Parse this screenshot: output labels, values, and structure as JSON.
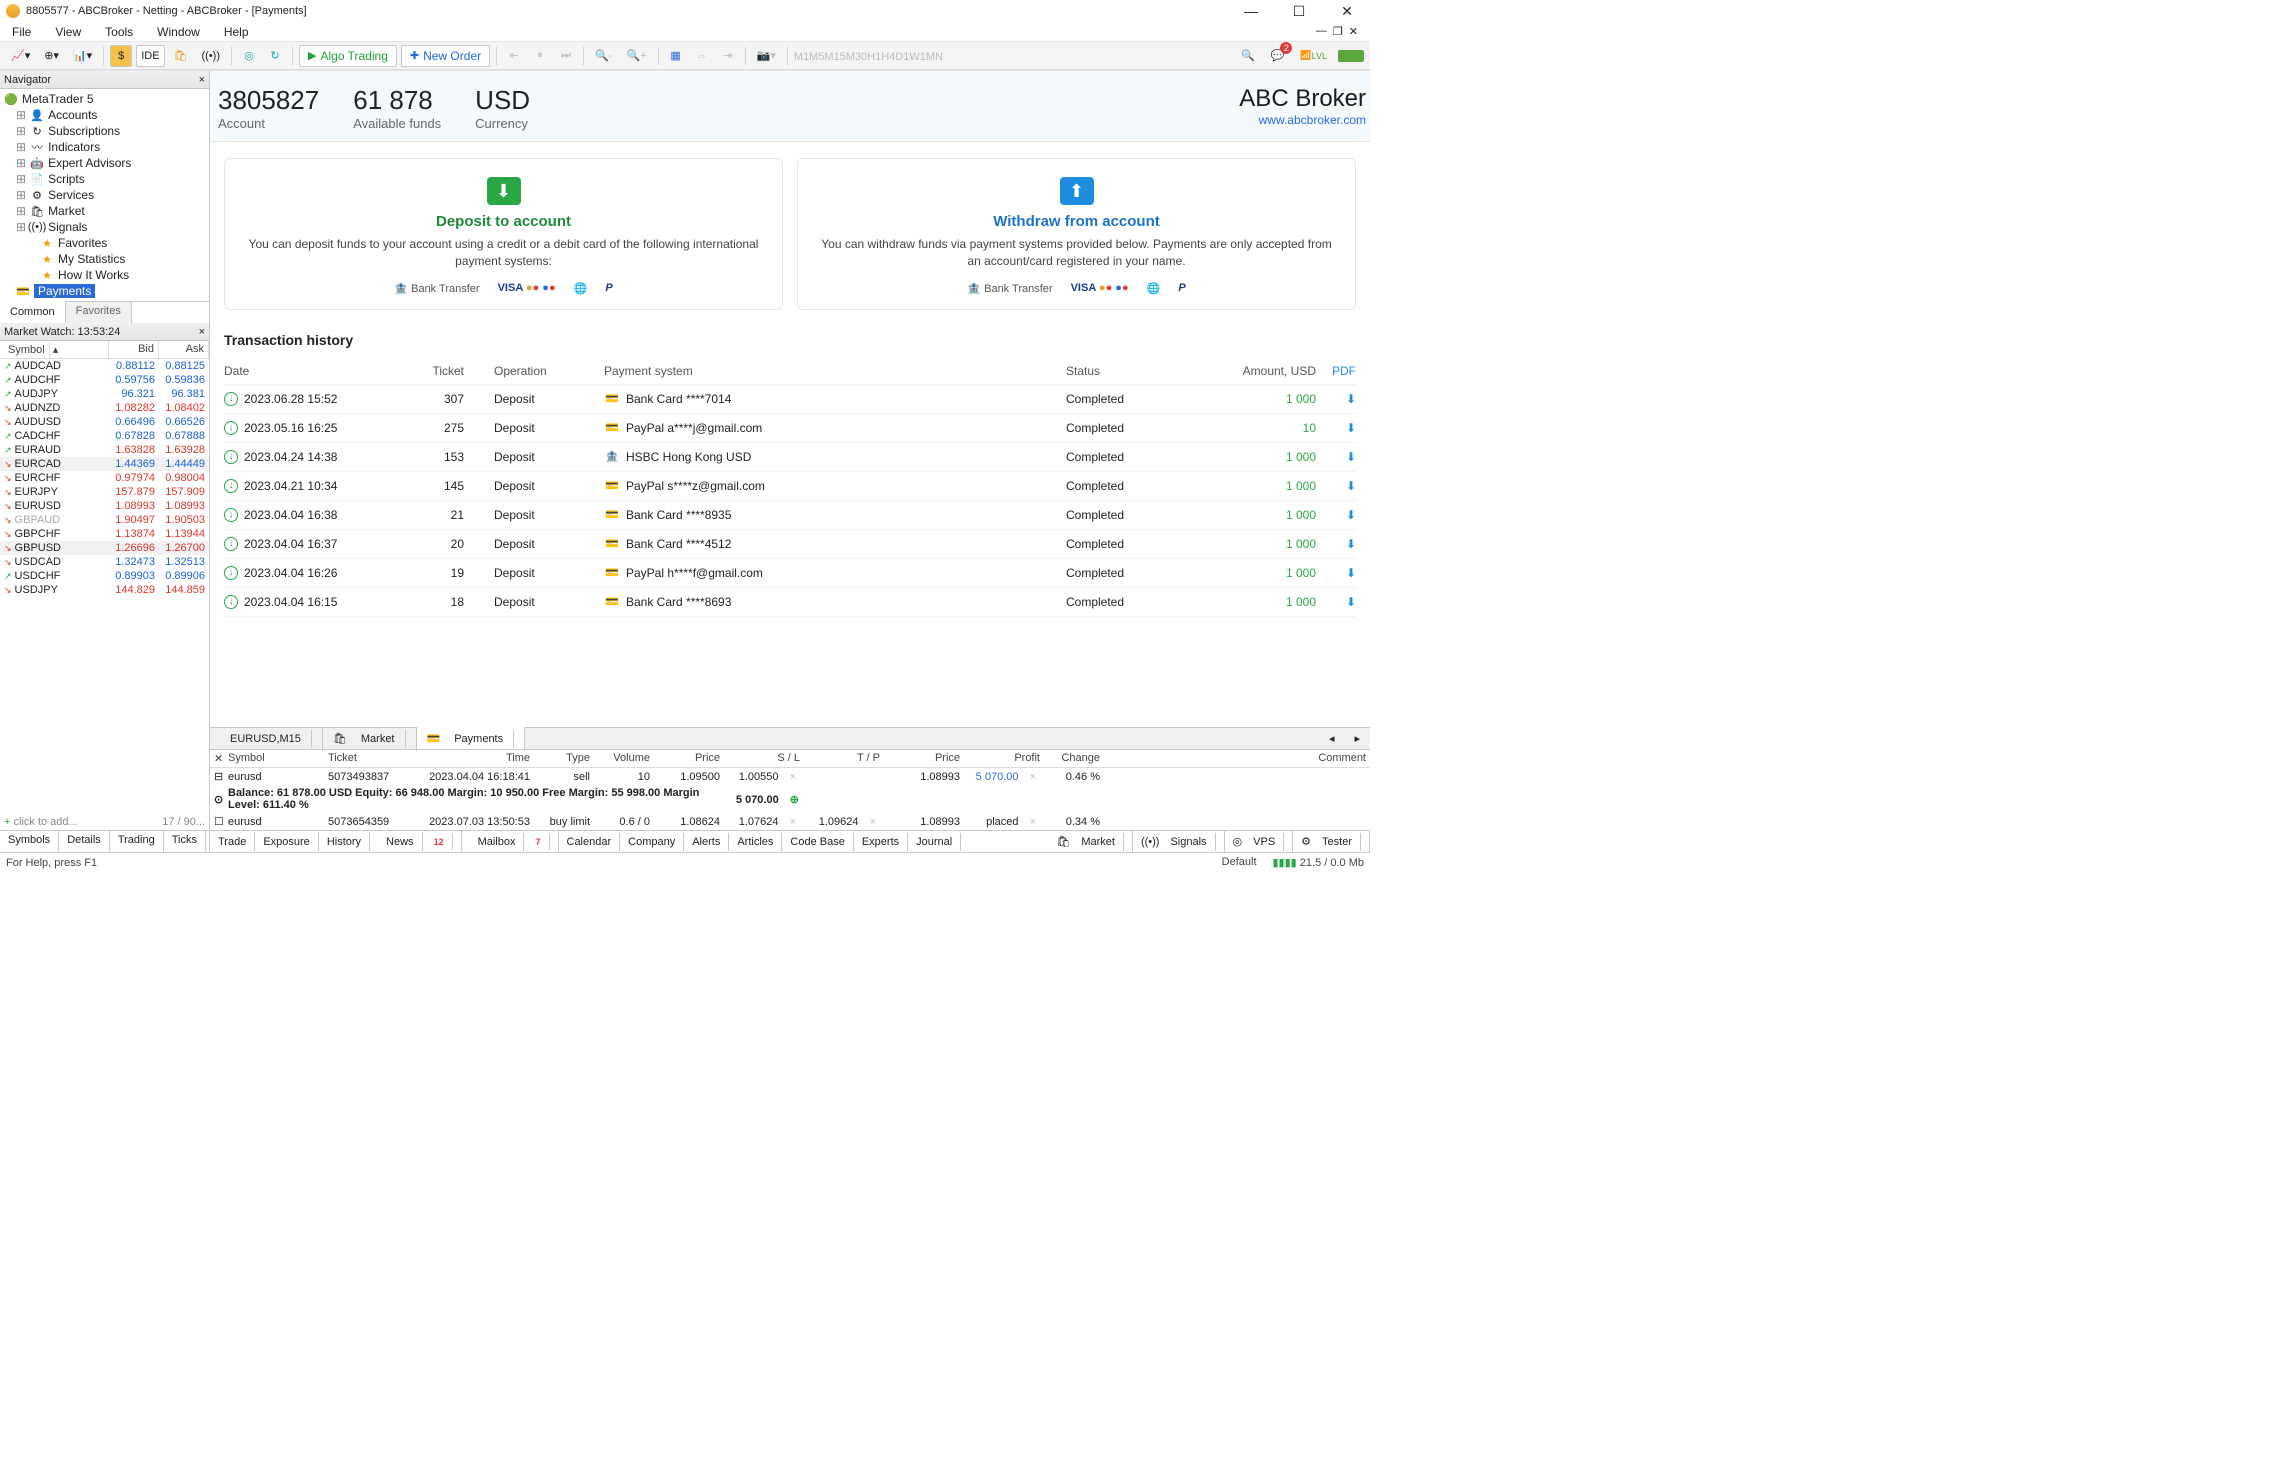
{
  "window": {
    "title": "8805577 - ABCBroker - Netting - ABCBroker - [Payments]"
  },
  "menu": {
    "file": "File",
    "view": "View",
    "tools": "Tools",
    "window": "Window",
    "help": "Help"
  },
  "toolbar": {
    "ide": "IDE",
    "algo": "Algo Trading",
    "neworder": "New Order",
    "timeframes": [
      "M1",
      "M5",
      "M15",
      "M30",
      "H1",
      "H4",
      "D1",
      "W1",
      "MN"
    ],
    "notif_count": "2",
    "lvl": "LVL"
  },
  "navigator": {
    "title": "Navigator",
    "root": "MetaTrader 5",
    "items": [
      "Accounts",
      "Subscriptions",
      "Indicators",
      "Expert Advisors",
      "Scripts",
      "Services",
      "Market",
      "Signals"
    ],
    "signals_children": [
      "Favorites",
      "My Statistics",
      "How It Works"
    ],
    "payments": "Payments",
    "tabs": {
      "common": "Common",
      "favorites": "Favorites"
    }
  },
  "marketwatch": {
    "title": "Market Watch: 13:53:24",
    "cols": {
      "symbol": "Symbol",
      "bid": "Bid",
      "ask": "Ask"
    },
    "rows": [
      {
        "d": "u",
        "s": "AUDCAD",
        "b": "0.88112",
        "a": "0.88125",
        "cls": "up"
      },
      {
        "d": "u",
        "s": "AUDCHF",
        "b": "0.59756",
        "a": "0.59836",
        "cls": "up"
      },
      {
        "d": "u",
        "s": "AUDJPY",
        "b": "96.321",
        "a": "96.381",
        "cls": "up"
      },
      {
        "d": "d",
        "s": "AUDNZD",
        "b": "1.08282",
        "a": "1.08402",
        "cls": "dn"
      },
      {
        "d": "d",
        "s": "AUDUSD",
        "b": "0.66496",
        "a": "0.66526",
        "cls": "up"
      },
      {
        "d": "u",
        "s": "CADCHF",
        "b": "0.67828",
        "a": "0.67888",
        "cls": "up"
      },
      {
        "d": "u",
        "s": "EURAUD",
        "b": "1.63828",
        "a": "1.63928",
        "cls": "dn"
      },
      {
        "d": "d",
        "s": "EURCAD",
        "b": "1.44369",
        "a": "1.44449",
        "cls": "up",
        "shade": true
      },
      {
        "d": "d",
        "s": "EURCHF",
        "b": "0.97974",
        "a": "0.98004",
        "cls": "dn"
      },
      {
        "d": "d",
        "s": "EURJPY",
        "b": "157.879",
        "a": "157.909",
        "cls": "dn"
      },
      {
        "d": "d",
        "s": "EURUSD",
        "b": "1.08993",
        "a": "1.08993",
        "cls": "dn"
      },
      {
        "d": "d",
        "s": "GBPAUD",
        "b": "1.90497",
        "a": "1.90503",
        "cls": "dn",
        "fade": true
      },
      {
        "d": "d",
        "s": "GBPCHF",
        "b": "1.13874",
        "a": "1.13944",
        "cls": "dn"
      },
      {
        "d": "d",
        "s": "GBPUSD",
        "b": "1.26696",
        "a": "1.26700",
        "cls": "dn",
        "shade": true
      },
      {
        "d": "d",
        "s": "USDCAD",
        "b": "1.32473",
        "a": "1.32513",
        "cls": "up"
      },
      {
        "d": "u",
        "s": "USDCHF",
        "b": "0.89903",
        "a": "0.89906",
        "cls": "up"
      },
      {
        "d": "d",
        "s": "USDJPY",
        "b": "144.829",
        "a": "144.859",
        "cls": "dn"
      }
    ],
    "add": "click to add...",
    "count": "17 / 90...",
    "tabs": {
      "symbols": "Symbols",
      "details": "Details",
      "trading": "Trading",
      "ticks": "Ticks"
    }
  },
  "account": {
    "number": "3805827",
    "number_lbl": "Account",
    "funds": "61 878",
    "funds_lbl": "Available funds",
    "ccy": "USD",
    "ccy_lbl": "Currency",
    "broker": "ABC Broker",
    "url": "www.abcbroker.com"
  },
  "deposit": {
    "title": "Deposit to account",
    "text": "You can deposit funds to your account using a credit or a debit card of the following international payment systems:",
    "bank": "Bank Transfer"
  },
  "withdraw": {
    "title": "Withdraw from account",
    "text": "You can withdraw funds via payment systems provided below. Payments are only accepted from an account/card registered in your name.",
    "bank": "Bank Transfer"
  },
  "history": {
    "title": "Transaction history",
    "cols": {
      "date": "Date",
      "ticket": "Ticket",
      "op": "Operation",
      "ps": "Payment system",
      "status": "Status",
      "amount": "Amount, USD",
      "pdf": "PDF"
    },
    "rows": [
      {
        "date": "2023.06.28 15:52",
        "tk": "307",
        "op": "Deposit",
        "ps": "Bank Card ****7014",
        "ico": "card",
        "st": "Completed",
        "am": "1 000"
      },
      {
        "date": "2023.05.16 16:25",
        "tk": "275",
        "op": "Deposit",
        "ps": "PayPal a****j@gmail.com",
        "ico": "card",
        "st": "Completed",
        "am": "10"
      },
      {
        "date": "2023.04.24 14:38",
        "tk": "153",
        "op": "Deposit",
        "ps": "HSBC Hong Kong USD",
        "ico": "bank",
        "st": "Completed",
        "am": "1 000"
      },
      {
        "date": "2023.04.21 10:34",
        "tk": "145",
        "op": "Deposit",
        "ps": "PayPal s****z@gmail.com",
        "ico": "card",
        "st": "Completed",
        "am": "1 000"
      },
      {
        "date": "2023.04.04 16:38",
        "tk": "21",
        "op": "Deposit",
        "ps": "Bank Card ****8935",
        "ico": "card",
        "st": "Completed",
        "am": "1 000"
      },
      {
        "date": "2023.04.04 16:37",
        "tk": "20",
        "op": "Deposit",
        "ps": "Bank Card ****4512",
        "ico": "card",
        "st": "Completed",
        "am": "1 000"
      },
      {
        "date": "2023.04.04 16:26",
        "tk": "19",
        "op": "Deposit",
        "ps": "PayPal h****f@gmail.com",
        "ico": "card",
        "st": "Completed",
        "am": "1 000"
      },
      {
        "date": "2023.04.04 16:15",
        "tk": "18",
        "op": "Deposit",
        "ps": "Bank Card ****8693",
        "ico": "card",
        "st": "Completed",
        "am": "1 000"
      }
    ]
  },
  "bottom_tabs": {
    "eurusd": "EURUSD,M15",
    "market": "Market",
    "payments": "Payments"
  },
  "toolbox": {
    "cols": {
      "symbol": "Symbol",
      "ticket": "Ticket",
      "time": "Time",
      "type": "Type",
      "volume": "Volume",
      "price": "Price",
      "sl": "S / L",
      "tp": "T / P",
      "price2": "Price",
      "profit": "Profit",
      "change": "Change",
      "comment": "Comment"
    },
    "row1": {
      "sym": "eurusd",
      "tk": "5073493837",
      "time": "2023.04.04 16:18:41",
      "type": "sell",
      "vol": "10",
      "price": "1.09500",
      "sl": "1.00550",
      "tp": "",
      "pr2": "1.08993",
      "prof": "5 070.00",
      "chg": "0.46 %"
    },
    "balance": "Balance: 61 878.00 USD   Equity: 66 948.00   Margin: 10 950.00   Free Margin: 55 998.00   Margin Level: 611.40 %",
    "bal_profit": "5 070.00",
    "row2": {
      "sym": "eurusd",
      "tk": "5073654359",
      "time": "2023.07.03 13:50:53",
      "type": "buy limit",
      "vol": "0.6 / 0",
      "price": "1.08624",
      "sl": "1.07624",
      "tp": "1.09624",
      "pr2": "1.08993",
      "prof": "placed",
      "chg": "0.34 %"
    },
    "tabs": {
      "trade": "Trade",
      "exposure": "Exposure",
      "history": "History",
      "news": "News",
      "news_n": "12",
      "mailbox": "Mailbox",
      "mailbox_n": "7",
      "calendar": "Calendar",
      "company": "Company",
      "alerts": "Alerts",
      "articles": "Articles",
      "codebase": "Code Base",
      "experts": "Experts",
      "journal": "Journal",
      "market": "Market",
      "signals": "Signals",
      "vps": "VPS",
      "tester": "Tester"
    }
  },
  "status": {
    "help": "For Help, press F1",
    "profile": "Default",
    "net": "21.5 / 0.0 Mb"
  }
}
